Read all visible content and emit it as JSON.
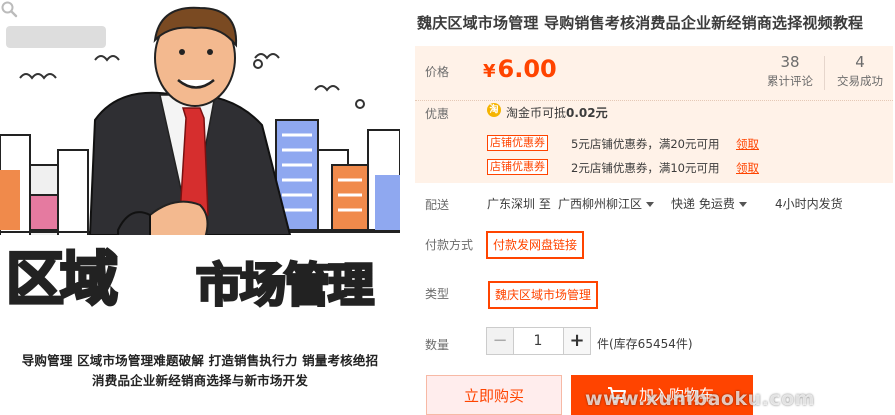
{
  "image": {
    "big_text_1": "区域",
    "big_text_2": "市场管理",
    "tagline_1": "导购管理  区域市场管理难题破解  打造销售执行力  销量考核绝招",
    "tagline_2": "消费品企业新经销商选择与新市场开发",
    "zoom_icon": "magnifier-icon"
  },
  "product": {
    "title": "魏庆区域市场管理 导购销售考核消费品企业新经销商选择视频教程"
  },
  "price": {
    "label": "价格",
    "currency": "¥",
    "amount": "6.00",
    "reviews_count": "38",
    "reviews_label": "累计评论",
    "deals_count": "4",
    "deals_label": "交易成功"
  },
  "promo": {
    "label": "优惠",
    "coin_icon": "淘",
    "coin_text_prefix": "淘金币可抵",
    "coin_amount": "0.02元",
    "coupons": [
      {
        "badge": "店铺优惠券",
        "text": "5元店铺优惠券，满20元可用",
        "claim": "领取"
      },
      {
        "badge": "店铺优惠券",
        "text": "2元店铺优惠券，满10元可用",
        "claim": "领取"
      }
    ]
  },
  "shipping": {
    "label": "配送",
    "from": "广东深圳 至",
    "to": "广西柳州柳江区",
    "method": "快递 免运费",
    "dispatch": "4小时内发货"
  },
  "payment": {
    "label": "付款方式",
    "option": "付款发网盘链接"
  },
  "type": {
    "label": "类型",
    "option": "魏庆区域市场管理"
  },
  "quantity": {
    "label": "数量",
    "minus": "−",
    "value": "1",
    "plus": "+",
    "stock": "件(库存65454件)"
  },
  "actions": {
    "buy_now": "立即购买",
    "add_cart": "加入购物车",
    "cart_icon": "shopping-cart-icon"
  },
  "watermark": "www.xunibaoku.com",
  "colors": {
    "accent": "#ff4400",
    "panel_bg": "#fff2e8"
  }
}
